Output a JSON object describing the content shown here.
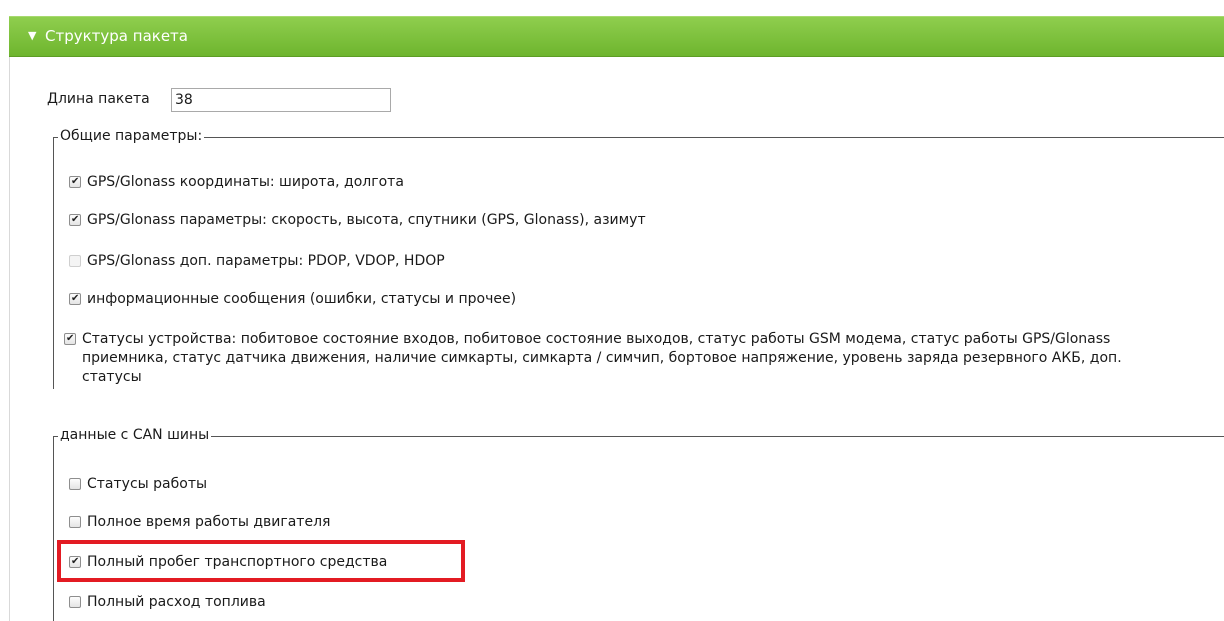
{
  "header": {
    "title": "Структура пакета",
    "arrow_icon": "triangle-down-icon",
    "color": "#7cc13c"
  },
  "packet_length": {
    "label": "Длина пакета",
    "value": "38"
  },
  "general": {
    "legend": "Общие параметры:",
    "options": [
      {
        "label": "GPS/Glonass координаты: широта, долгота",
        "checked": true
      },
      {
        "label": "GPS/Glonass параметры: скорость, высота, спутники (GPS, Glonass), азимут",
        "checked": true
      },
      {
        "label": "GPS/Glonass доп. параметры: PDOP, VDOP, HDOP",
        "checked": false
      },
      {
        "label": "информационные сообщения (ошибки, статусы и прочее)",
        "checked": true
      },
      {
        "label": "Статусы устройства: побитовое состояние входов, побитовое состояние выходов, статус работы GSM модема, статус работы GPS/Glonass приемника, статус датчика движения, наличие симкарты, симкарта / симчип, бортовое напряжение, уровень заряда резервного АКБ, доп. статусы",
        "checked": true
      }
    ]
  },
  "can": {
    "legend": "данные с CAN шины",
    "options": [
      {
        "label": "Статусы работы",
        "checked": false
      },
      {
        "label": "Полное время работы двигателя",
        "checked": false
      },
      {
        "label": "Полный пробег транспортного средства",
        "checked": true
      },
      {
        "label": "Полный расход топлива",
        "checked": false
      }
    ]
  },
  "highlight_color": "#e31b23"
}
